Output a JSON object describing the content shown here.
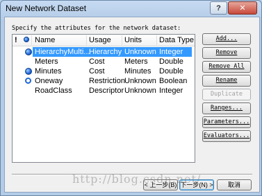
{
  "window": {
    "title": "New Network Dataset",
    "help_button": "?",
    "close_button": "✕"
  },
  "instruction": "Specify the attributes for the network dataset:",
  "table": {
    "header": {
      "bang": "!",
      "name": "Name",
      "usage": "Usage",
      "units": "Units",
      "data_type": "Data Type"
    },
    "rows": [
      {
        "name": "HierarchyMulti...",
        "usage": "Hierarchy",
        "units": "Unknown",
        "data_type": "Integer",
        "default_icon": "filled",
        "selected": true
      },
      {
        "name": "Meters",
        "usage": "Cost",
        "units": "Meters",
        "data_type": "Double",
        "default_icon": "none",
        "selected": false
      },
      {
        "name": "Minutes",
        "usage": "Cost",
        "units": "Minutes",
        "data_type": "Double",
        "default_icon": "filled",
        "selected": false
      },
      {
        "name": "Oneway",
        "usage": "Restriction",
        "units": "Unknown",
        "data_type": "Boolean",
        "default_icon": "hollow",
        "selected": false
      },
      {
        "name": "RoadClass",
        "usage": "Descriptor",
        "units": "Unknown",
        "data_type": "Integer",
        "default_icon": "none",
        "selected": false
      }
    ]
  },
  "side_buttons": {
    "add": "Add...",
    "remove": "Remove",
    "remove_all": "Remove All",
    "rename": "Rename",
    "duplicate": "Duplicate",
    "ranges": "Ranges...",
    "parameters": "Parameters...",
    "evaluators": "Evaluators..."
  },
  "nav": {
    "back": "< 上一步(B)",
    "next": "下一步(N) >",
    "cancel": "取消"
  },
  "watermark": "http://blog.csdn.net/",
  "colors": {
    "selection": "#3399ff",
    "default_icon": "#1f66d6"
  }
}
